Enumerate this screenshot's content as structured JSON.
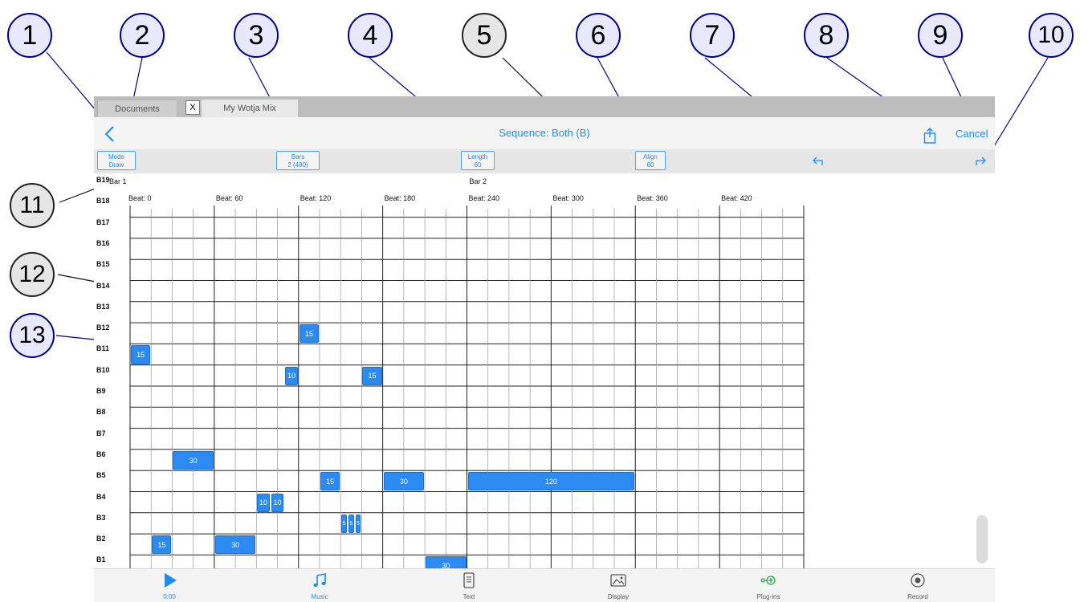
{
  "callouts": [
    "1",
    "2",
    "3",
    "4",
    "5",
    "6",
    "7",
    "8",
    "9",
    "10",
    "11",
    "12",
    "13"
  ],
  "tabs": {
    "documents": "Documents",
    "close": "X",
    "active": "My Wotja Mix"
  },
  "nav": {
    "title": "Sequence: Both (B)",
    "cancel": "Cancel"
  },
  "toolbar": {
    "mode": {
      "label": "Mode",
      "value": "Draw"
    },
    "bars": {
      "label": "Bars",
      "value": "2 (480)"
    },
    "length": {
      "label": "Length",
      "value": "60"
    },
    "align": {
      "label": "Align",
      "value": "60"
    }
  },
  "grid": {
    "rows": [
      "B19",
      "B18",
      "B17",
      "B16",
      "B15",
      "B14",
      "B13",
      "B12",
      "B11",
      "B10",
      "B9",
      "B8",
      "B7",
      "B6",
      "B5",
      "B4",
      "B3",
      "B2",
      "B1"
    ],
    "bars": [
      {
        "label": "Bar 1",
        "beat": 0
      },
      {
        "label": "Bar 2",
        "beat": 240
      }
    ],
    "beats": [
      {
        "label": "Beat: 0",
        "beat": 0
      },
      {
        "label": "Beat: 60",
        "beat": 60
      },
      {
        "label": "Beat: 120",
        "beat": 120
      },
      {
        "label": "Beat: 180",
        "beat": 180
      },
      {
        "label": "Beat: 240",
        "beat": 240
      },
      {
        "label": "Beat: 300",
        "beat": 300
      },
      {
        "label": "Beat: 360",
        "beat": 360
      },
      {
        "label": "Beat: 420",
        "beat": 420
      }
    ],
    "total_beats": 480,
    "beats_per_column": 15
  },
  "notes": [
    {
      "row": "B12",
      "start": 120,
      "length": 15,
      "label": "15"
    },
    {
      "row": "B11",
      "start": 0,
      "length": 15,
      "label": "15"
    },
    {
      "row": "B10",
      "start": 110,
      "length": 10,
      "label": "10"
    },
    {
      "row": "B10",
      "start": 165,
      "length": 15,
      "label": "15"
    },
    {
      "row": "B6",
      "start": 30,
      "length": 30,
      "label": "30"
    },
    {
      "row": "B5",
      "start": 135,
      "length": 15,
      "label": "15"
    },
    {
      "row": "B5",
      "start": 180,
      "length": 30,
      "label": "30"
    },
    {
      "row": "B5",
      "start": 240,
      "length": 120,
      "label": "120"
    },
    {
      "row": "B4",
      "start": 90,
      "length": 10,
      "label": "10"
    },
    {
      "row": "B4",
      "start": 100,
      "length": 10,
      "label": "10"
    },
    {
      "row": "B3",
      "start": 150,
      "length": 5,
      "label": "5"
    },
    {
      "row": "B3",
      "start": 155,
      "length": 5,
      "label": "5"
    },
    {
      "row": "B3",
      "start": 160,
      "length": 5,
      "label": "5"
    },
    {
      "row": "B2",
      "start": 15,
      "length": 15,
      "label": "15"
    },
    {
      "row": "B2",
      "start": 60,
      "length": 30,
      "label": "30"
    },
    {
      "row": "B1",
      "start": 210,
      "length": 30,
      "label": "30"
    }
  ],
  "tabbar": {
    "play": {
      "label": "0:00",
      "icon": "play-icon"
    },
    "music": {
      "label": "Music",
      "icon": "music-note-icon"
    },
    "text": {
      "label": "Text",
      "icon": "document-icon"
    },
    "display": {
      "label": "Display",
      "icon": "image-icon"
    },
    "plugins": {
      "label": "Plug-ins",
      "icon": "plugin-icon"
    },
    "record": {
      "label": "Record",
      "icon": "record-icon"
    }
  },
  "colors": {
    "accent": "#1a8cff",
    "note": "#2b8bf2",
    "plugin": "#2aa84a",
    "callout_fill": "#e8e8ff",
    "callout_border": "#00008b"
  }
}
